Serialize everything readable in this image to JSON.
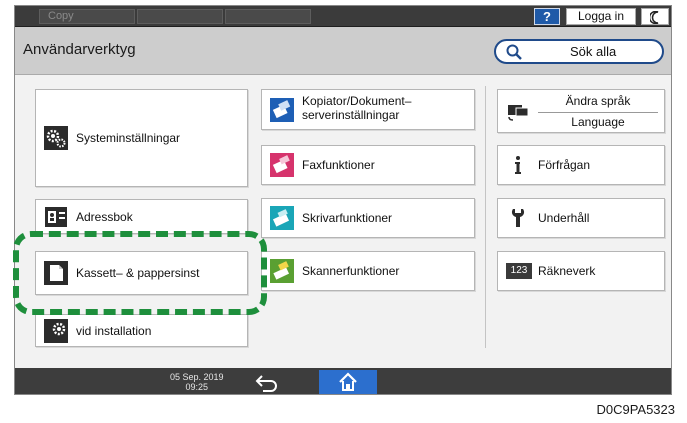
{
  "topbar": {
    "tab_1": "Copy",
    "help_label": "?",
    "login_label": "Logga in"
  },
  "header": {
    "title": "Användarverktyg",
    "search_label": "Sök alla"
  },
  "tiles": {
    "system_settings": "Systeminställningar",
    "copier_line1": "Kopiator/Dokument–",
    "copier_line2": "serverinställningar",
    "fax": "Faxfunktioner",
    "printer": "Skrivarfunktioner",
    "scanner": "Skannerfunktioner",
    "address_book": "Adressbok",
    "tray_paper": "Kassett– & pappersinst",
    "installation": "vid installation",
    "language_line1": "Ändra språk",
    "language_line2": "Language",
    "inquiry": "Förfrågan",
    "maintenance": "Underhåll",
    "counter": "Räkneverk",
    "counter_icon_text": "123"
  },
  "bottombar": {
    "date": "05 Sep. 2019",
    "time": "09:25"
  },
  "caption": "D0C9PA5323",
  "colors": {
    "highlight": "#1e8f3c",
    "accent_blue": "#1f5aa8",
    "home_blue": "#2c6fce"
  },
  "icons": {
    "system_settings": "gears-icon",
    "copier": "copier-icon",
    "fax": "fax-icon",
    "printer": "printer-icon",
    "scanner": "scanner-icon",
    "address_book": "address-book-icon",
    "tray_paper": "paper-icon",
    "language": "language-switch-icon",
    "inquiry": "info-icon",
    "maintenance": "wrench-icon",
    "counter": "counter-icon",
    "search": "search-icon",
    "back": "back-arrow-icon",
    "home": "home-icon",
    "energy": "moon-icon"
  }
}
